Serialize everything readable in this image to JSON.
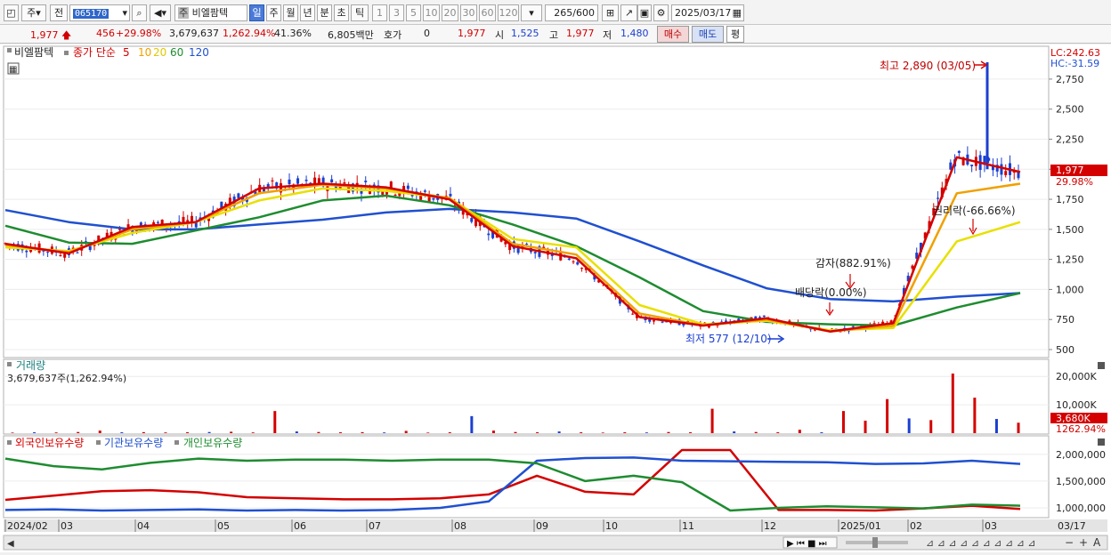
{
  "toolbar": {
    "market": "주",
    "ref": "전",
    "code": "065170",
    "name_prefix": "주",
    "name": "비엘팜텍",
    "periods": [
      "일",
      "주",
      "월",
      "년",
      "분",
      "초",
      "틱"
    ],
    "nums": [
      "1",
      "3",
      "5",
      "10",
      "20",
      "30",
      "60",
      "120"
    ],
    "count": "265",
    "count_max": "/600",
    "date": "2025/03/17"
  },
  "quote": {
    "price": "1,977",
    "change": "456",
    "change_pct": "+29.98%",
    "volume": "3,679,637",
    "vol_pct": "1,262.94%",
    "turnover": "41.36%",
    "amount": "6,805백만",
    "hoga_label": "호가",
    "hoga_val": "0",
    "hoga_price": "1,977",
    "open_label": "시",
    "open": "1,525",
    "high_label": "고",
    "high": "1,977",
    "low_label": "저",
    "low": "1,480",
    "buy": "매수",
    "sell": "매도",
    "eval": "평"
  },
  "legend": {
    "name": "비엘팜텍",
    "ma_label": "종가 단순",
    "ma": [
      "5",
      "10",
      "20",
      "60",
      "120"
    ],
    "ma_colors": [
      "#d40000",
      "#f0a000",
      "#e8e000",
      "#1e8c30",
      "#2050d0"
    ]
  },
  "annotations": {
    "high": "최고 2,890 (03/05)",
    "low": "최저 577 (12/10)",
    "dividend": "배당락(0.00%)",
    "reduction": "감자(882.91%)",
    "rights": "권리락(-66.66%)",
    "lc": "LC:242.63",
    "hc": "HC:-31.59",
    "last_price": "1,977",
    "last_pct": "29.98%"
  },
  "volume_panel": {
    "title": "거래량",
    "value": "3,679,637주(1,262.94%)",
    "last": "3,680K",
    "last_pct": "1262.94%"
  },
  "holdings_panel": {
    "labels": [
      "외국인보유수량",
      "기관보유수량",
      "개인보유수량"
    ],
    "colors": [
      "#d40000",
      "#2050d0",
      "#1e8c30"
    ]
  },
  "chart_data": [
    {
      "type": "line",
      "title": "비엘팜텍",
      "x": [
        "2024/02",
        "03",
        "04",
        "05",
        "06",
        "07",
        "08",
        "09",
        "10",
        "11",
        "12",
        "2025/01",
        "02",
        "03",
        "03/17"
      ],
      "ylim": [
        500,
        2890
      ],
      "y_ticks": [
        "2,750",
        "2,500",
        "2,250",
        "2,000",
        "1,750",
        "1,500",
        "1,250",
        "1,000",
        "750",
        "500"
      ],
      "series": [
        {
          "name": "5",
          "values": [
            1380,
            1300,
            1520,
            1560,
            1840,
            1880,
            1850,
            1750,
            1360,
            1260,
            770,
            700,
            760,
            650,
            720,
            2100,
            1977
          ]
        },
        {
          "name": "10",
          "values": [
            1370,
            1310,
            1500,
            1560,
            1800,
            1870,
            1840,
            1760,
            1380,
            1290,
            800,
            700,
            750,
            650,
            700,
            1800,
            1880
          ]
        },
        {
          "name": "20",
          "values": [
            1350,
            1320,
            1470,
            1560,
            1740,
            1840,
            1820,
            1760,
            1420,
            1350,
            870,
            710,
            740,
            660,
            680,
            1400,
            1560
          ]
        },
        {
          "name": "60",
          "values": [
            1530,
            1390,
            1380,
            1490,
            1600,
            1740,
            1780,
            1700,
            1540,
            1360,
            1100,
            820,
            730,
            710,
            700,
            850,
            970
          ]
        },
        {
          "name": "120",
          "values": [
            1660,
            1560,
            1500,
            1500,
            1540,
            1580,
            1640,
            1670,
            1640,
            1590,
            1400,
            1200,
            1010,
            920,
            900,
            940,
            970
          ]
        }
      ]
    },
    {
      "type": "bar",
      "title": "거래량",
      "y_ticks": [
        "20,000K",
        "10,000K"
      ],
      "values": [
        200,
        300,
        250,
        400,
        900,
        300,
        350,
        250,
        300,
        400,
        500,
        250,
        7800,
        600,
        400,
        300,
        350,
        250,
        800,
        200,
        300,
        6000,
        900,
        400,
        300,
        600,
        300,
        200,
        300,
        250,
        400,
        300,
        8600,
        600,
        400,
        300,
        1200,
        300,
        7800,
        4400,
        12000,
        5200,
        4600,
        21000,
        12500,
        5000,
        3680
      ]
    },
    {
      "type": "line",
      "y_ticks": [
        "2,000,000",
        "1,500,000",
        "1,000,000"
      ],
      "series": [
        {
          "name": "외국인보유수량",
          "values": [
            1150000,
            1230000,
            1310000,
            1330000,
            1290000,
            1200000,
            1180000,
            1160000,
            1160000,
            1180000,
            1250000,
            1600000,
            1300000,
            1250000,
            2080000,
            2080000,
            960000,
            960000,
            950000,
            990000,
            1040000,
            980000
          ]
        },
        {
          "name": "기관보유수량",
          "values": [
            960000,
            970000,
            950000,
            960000,
            970000,
            950000,
            960000,
            950000,
            960000,
            1000000,
            1120000,
            1880000,
            1930000,
            1940000,
            1880000,
            1870000,
            1860000,
            1850000,
            1820000,
            1830000,
            1880000,
            1820000
          ]
        },
        {
          "name": "개인보유수량",
          "values": [
            1920000,
            1780000,
            1720000,
            1840000,
            1920000,
            1880000,
            1900000,
            1900000,
            1880000,
            1900000,
            1900000,
            1830000,
            1500000,
            1600000,
            1480000,
            950000,
            1000000,
            1030000,
            1010000,
            990000,
            1060000,
            1040000
          ]
        }
      ]
    }
  ]
}
